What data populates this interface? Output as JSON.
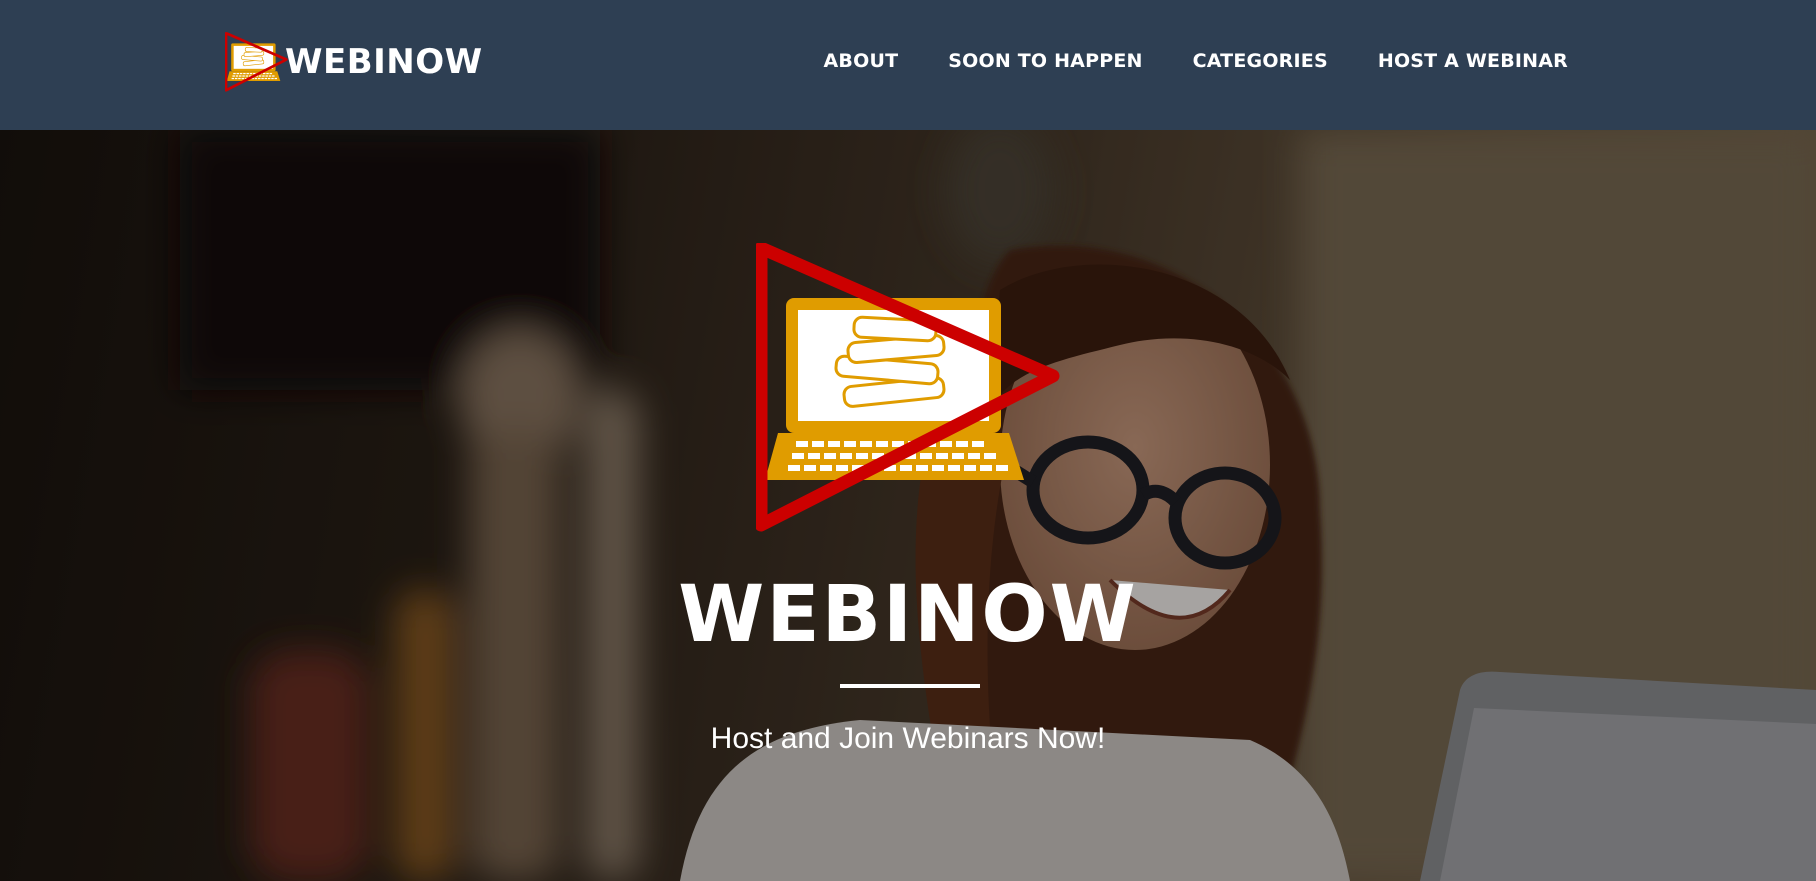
{
  "brand": {
    "name": "WEBINOW",
    "logo_icon": "laptop-books-play-icon"
  },
  "nav": {
    "items": [
      {
        "label": "ABOUT"
      },
      {
        "label": "SOON TO HAPPEN"
      },
      {
        "label": "CATEGORIES"
      },
      {
        "label": "HOST A WEBINAR"
      }
    ]
  },
  "hero": {
    "title": "WEBINOW",
    "subtitle": "Host and Join Webinars Now!",
    "logo_icon": "laptop-books-play-icon",
    "background_image": "woman-with-glasses-smiling-at-laptop-photo"
  },
  "colors": {
    "navbar": "#2e3f53",
    "logo_gold": "#e09c00",
    "logo_red": "#cc0000",
    "text": "#ffffff"
  }
}
